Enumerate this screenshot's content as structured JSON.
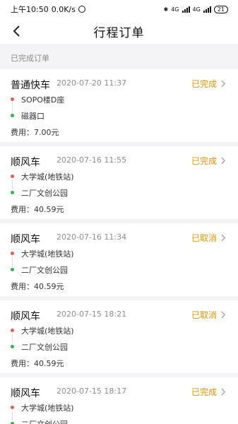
{
  "status_bar": {
    "time": "上午10:50",
    "speed": "0.0K/s",
    "network1": "4G",
    "network2": "4G",
    "battery": "21"
  },
  "header": {
    "title": "行程订单"
  },
  "section": {
    "label": "已完成订单"
  },
  "orders": [
    {
      "type": "普通快车",
      "time": "2020-07-20 11:37",
      "status": "已完成",
      "start": "SOPO楼D座",
      "end": "磁器口",
      "fee": "费用：7.00元"
    },
    {
      "type": "顺风车",
      "time": "2020-07-16 11:55",
      "status": "已完成",
      "start": "大学城(地铁站)",
      "end": "二厂文创公园",
      "fee": "费用：40.59元"
    },
    {
      "type": "顺风车",
      "time": "2020-07-16 11:34",
      "status": "已取消",
      "start": "大学城(地铁站)",
      "end": "二厂文创公园",
      "fee": "费用：40.59元"
    },
    {
      "type": "顺风车",
      "time": "2020-07-15 18:21",
      "status": "已取消",
      "start": "大学城(地铁站)",
      "end": "二厂文创公园",
      "fee": "费用：40.59元"
    },
    {
      "type": "顺风车",
      "time": "2020-07-15 18:17",
      "status": "已完成",
      "start": "大学城(地铁站)",
      "end": "二厂文创公园",
      "fee": ""
    }
  ],
  "colors": {
    "status": "#e39400",
    "start_dot": "#e45b4d",
    "end_dot": "#2fb64a"
  }
}
